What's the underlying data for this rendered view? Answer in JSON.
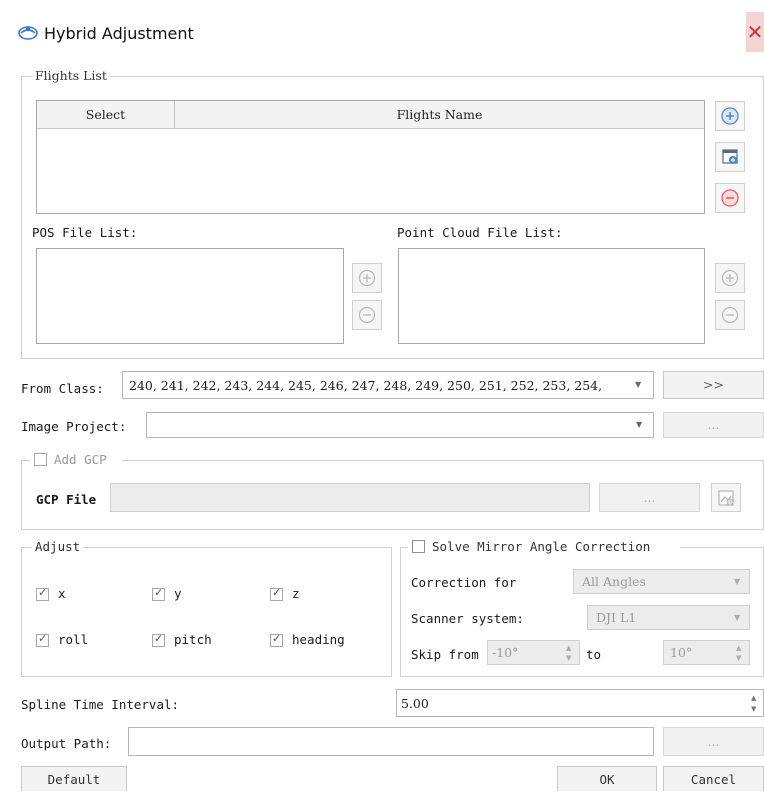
{
  "window": {
    "title": "Hybrid Adjustment",
    "close_glyph": "✕"
  },
  "flights_list": {
    "legend": "Flights List",
    "columns": [
      "Select",
      "Flights Name"
    ],
    "add_button_icon": "add-flight-icon",
    "import_button_icon": "import-flight-icon",
    "remove_button_icon": "remove-flight-icon"
  },
  "pos_file_list": {
    "label": "POS File List:"
  },
  "point_cloud_file_list": {
    "label": "Point Cloud File List:"
  },
  "from_class": {
    "label": "From Class:",
    "value": "240, 241, 242, 243, 244, 245, 246, 247, 248, 249, 250, 251, 252, 253, 254,",
    "button": ">>"
  },
  "image_project": {
    "label": "Image Project:",
    "value": "",
    "browse": "..."
  },
  "gcp": {
    "checkbox_label": "Add GCP",
    "checked": false,
    "file_label": "GCP File",
    "file_value": "",
    "browse": "..."
  },
  "adjust": {
    "legend": "Adjust",
    "items": [
      {
        "label": "x",
        "checked": true
      },
      {
        "label": "y",
        "checked": true
      },
      {
        "label": "z",
        "checked": true
      },
      {
        "label": "roll",
        "checked": true
      },
      {
        "label": "pitch",
        "checked": true
      },
      {
        "label": "heading",
        "checked": true
      }
    ]
  },
  "mirror": {
    "checkbox_label": "Solve Mirror Angle Correction",
    "checked": false,
    "correction_label": "Correction for",
    "correction_value": "All Angles",
    "scanner_label": "Scanner system:",
    "scanner_value": "DJI L1",
    "skip_label": "Skip from",
    "skip_from": "-10°",
    "to_label": "to",
    "skip_to": "10°"
  },
  "spline": {
    "label": "Spline Time Interval:",
    "value": "5.00"
  },
  "output": {
    "label": "Output Path:",
    "value": "",
    "browse": "..."
  },
  "footer": {
    "default": "Default",
    "ok": "OK",
    "cancel": "Cancel"
  },
  "colors": {
    "accent_blue": "#4f86d9",
    "remove_red": "#e06060",
    "close_bg": "#f4d3d3"
  }
}
